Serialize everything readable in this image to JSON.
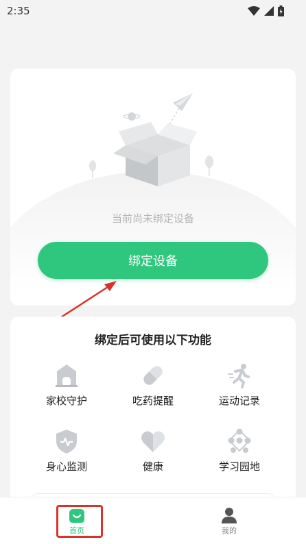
{
  "status_bar": {
    "time": "2:35",
    "icons": [
      "wifi-icon",
      "cell-signal-icon",
      "battery-icon"
    ]
  },
  "device_card": {
    "empty_text": "当前尚未绑定设备",
    "bind_button_label": "绑定设备"
  },
  "features": {
    "title": "绑定后可使用以下功能",
    "items": [
      {
        "label": "家校守护",
        "icon": "school-icon"
      },
      {
        "label": "吃药提醒",
        "icon": "pill-icon"
      },
      {
        "label": "运动记录",
        "icon": "running-icon"
      },
      {
        "label": "身心监测",
        "icon": "shield-pulse-icon"
      },
      {
        "label": "健康",
        "icon": "heart-icon"
      },
      {
        "label": "学习园地",
        "icon": "learning-icon"
      }
    ]
  },
  "bottom_nav": {
    "items": [
      {
        "label": "首页",
        "icon": "home-icon",
        "active": true
      },
      {
        "label": "我的",
        "icon": "user-icon",
        "active": false
      }
    ]
  },
  "colors": {
    "accent": "#2ec77d",
    "annotation": "#d9322a",
    "icon_gray": "#c8ccd1"
  }
}
